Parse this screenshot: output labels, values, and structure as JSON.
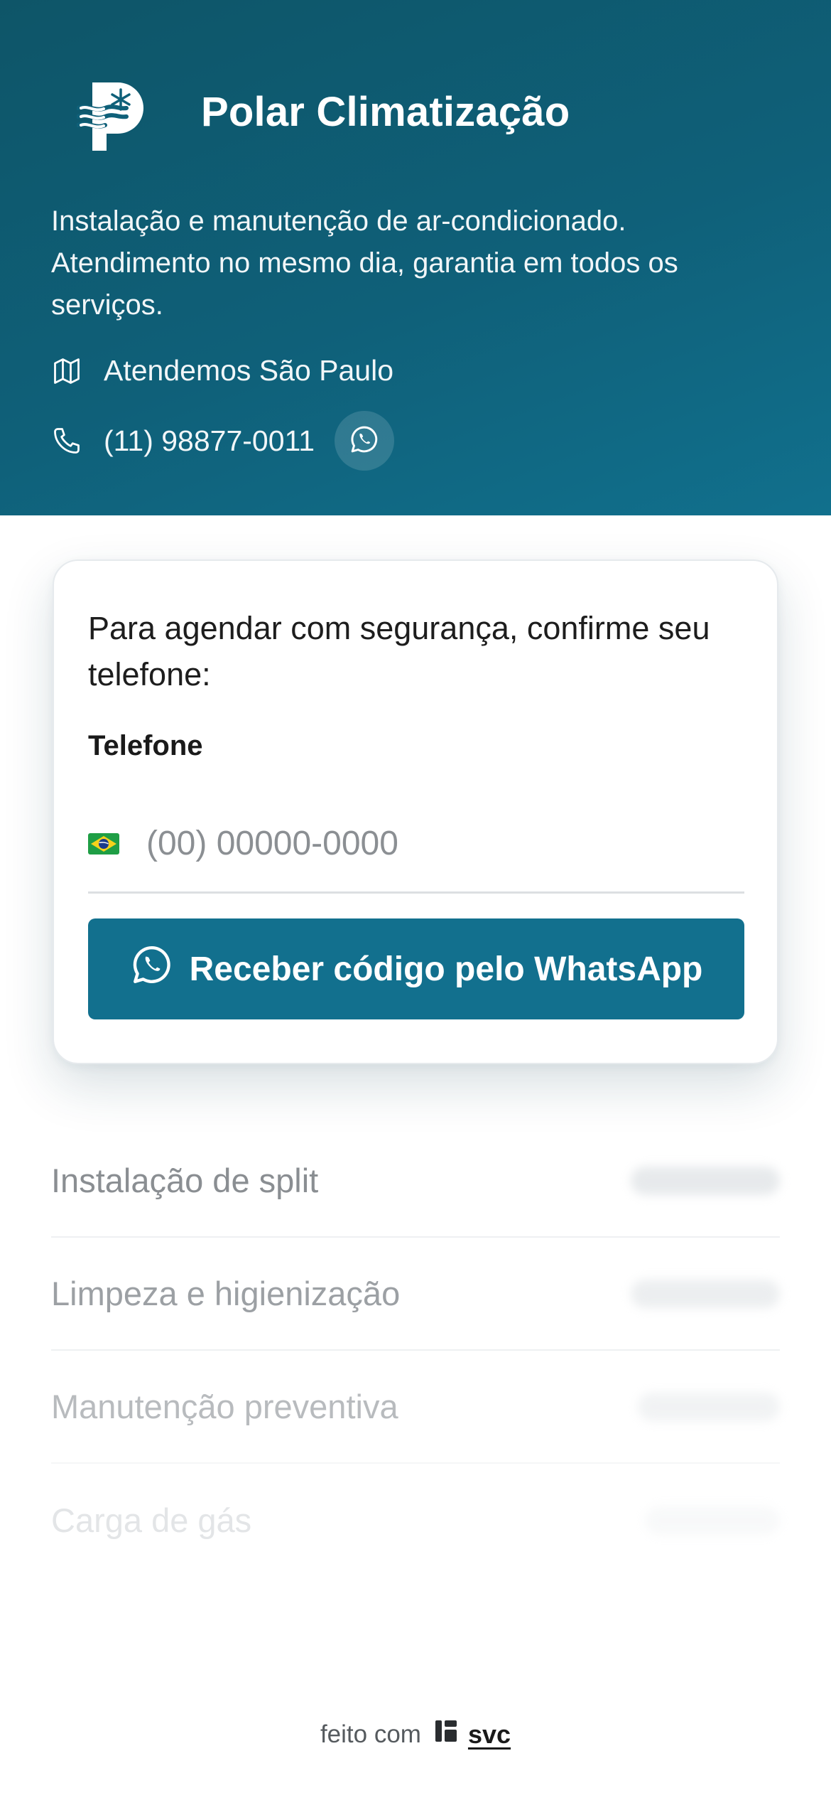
{
  "header": {
    "brand_name": "Polar Climatização",
    "description": "Instalação e manutenção de ar-condicionado. Atendimento no mesmo dia, garantia em todos os serviços.",
    "service_area": "Atendemos São Paulo",
    "phone": "(11) 98877-0011",
    "icons": [
      "polar-logo",
      "map-icon",
      "phone-icon",
      "whatsapp-icon"
    ],
    "colors": {
      "header_bg": "#0f6079",
      "header_text": "#ffffff"
    }
  },
  "verification_card": {
    "prompt": "Para agendar com segurança, confirme seu telefone:",
    "field_label": "Telefone",
    "phone_placeholder": "(00) 00000-0000",
    "phone_value": "",
    "country_flag": "brazil-flag-icon",
    "submit_label": "Receber código pelo WhatsApp",
    "colors": {
      "button_bg": "#12708e",
      "button_text": "#ffffff"
    }
  },
  "services": [
    {
      "name": "Instalação de split"
    },
    {
      "name": "Limpeza e higienização"
    },
    {
      "name": "Manutenção preventiva"
    },
    {
      "name": "Carga de gás"
    }
  ],
  "footer": {
    "made_with": "feito com",
    "brand": "svc"
  }
}
